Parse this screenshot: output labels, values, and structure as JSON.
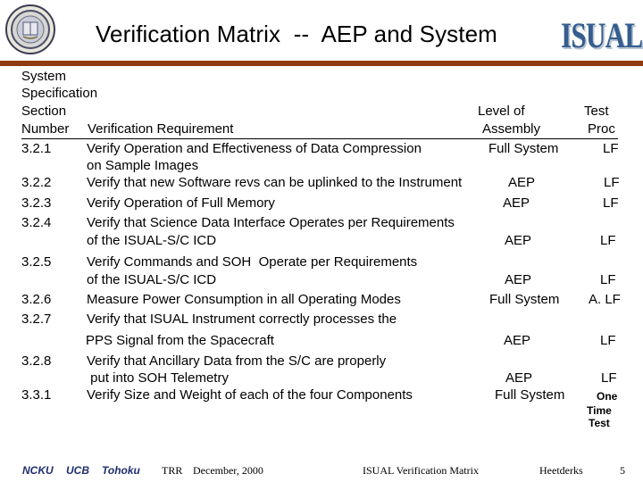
{
  "header": {
    "title": "Verification Matrix  --  AEP and System",
    "logo_text": "ISUAL",
    "seal_icon": "university-seal-icon",
    "rule_color": "#8f3a10"
  },
  "table": {
    "columns": {
      "section": [
        "System",
        "Specification",
        "Section",
        "Number"
      ],
      "requirement": "Verification Requirement",
      "level": [
        "Level of",
        "Assembly"
      ],
      "proc": [
        "Test",
        "Proc"
      ]
    },
    "rows": [
      {
        "section": "3.2.1",
        "requirement": [
          "Verify Operation and Effectiveness of Data Compression",
          "on Sample Images"
        ],
        "level": "Full System",
        "proc": "LF"
      },
      {
        "section": "3.2.2",
        "requirement": [
          "Verify that new Software revs can be uplinked to the Instrument"
        ],
        "level": "AEP",
        "proc": "LF"
      },
      {
        "section": "3.2.3",
        "requirement": [
          "Verify Operation of Full Memory"
        ],
        "level": "AEP",
        "proc": "LF"
      },
      {
        "section": "3.2.4",
        "requirement": [
          "Verify that Science Data Interface Operates per Requirements",
          "of the ISUAL-S/C ICD"
        ],
        "level": "AEP",
        "proc": "LF"
      },
      {
        "section": "3.2.5",
        "requirement": [
          "Verify Commands and SOH  Operate per Requirements",
          "of the ISUAL-S/C ICD"
        ],
        "level": "AEP",
        "proc": "LF"
      },
      {
        "section": "3.2.6",
        "requirement": [
          "Measure Power Consumption in all Operating Modes"
        ],
        "level": "Full System",
        "proc": "A. LF"
      },
      {
        "section": "3.2.7",
        "requirement": [
          "Verify that ISUAL Instrument correctly processes the",
          "PPS Signal from the Spacecraft"
        ],
        "level": "AEP",
        "proc": "LF"
      },
      {
        "section": "3.2.8",
        "requirement": [
          "Verify that Ancillary Data from the S/C are properly",
          " put into SOH Telemetry"
        ],
        "level": "AEP",
        "proc": "LF"
      },
      {
        "section": "3.3.1",
        "requirement": [
          "Verify Size and Weight of each of the four Components"
        ],
        "level": "Full System",
        "proc": [
          "One",
          "Time",
          "Test"
        ]
      }
    ]
  },
  "footer": {
    "orgs": [
      "NCKU",
      "UCB",
      "Tohoku"
    ],
    "event": "TRR",
    "date": "December, 2000",
    "doc_title": "ISUAL Verification Matrix",
    "author": "Heetderks",
    "page": "5"
  }
}
